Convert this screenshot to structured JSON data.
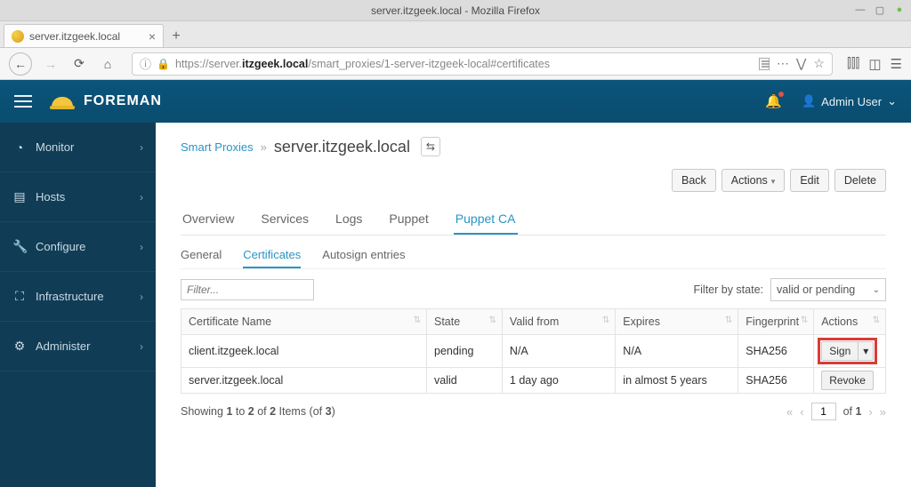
{
  "os": {
    "title": "server.itzgeek.local - Mozilla Firefox"
  },
  "browser": {
    "tab_title": "server.itzgeek.local",
    "url_prefix": "https://server.",
    "url_bold": "itzgeek.local",
    "url_suffix": "/smart_proxies/1-server-itzgeek-local#certificates"
  },
  "app": {
    "brand": "FOREMAN",
    "user_label": "Admin User"
  },
  "sidebar": {
    "items": [
      {
        "label": "Monitor",
        "icon": "dashboard"
      },
      {
        "label": "Hosts",
        "icon": "servers"
      },
      {
        "label": "Configure",
        "icon": "wrench"
      },
      {
        "label": "Infrastructure",
        "icon": "sitemap"
      },
      {
        "label": "Administer",
        "icon": "gear"
      }
    ]
  },
  "breadcrumb": {
    "root": "Smart Proxies",
    "current": "server.itzgeek.local"
  },
  "toolbar": {
    "back": "Back",
    "actions": "Actions",
    "edit": "Edit",
    "delete": "Delete"
  },
  "tabs": {
    "main": [
      "Overview",
      "Services",
      "Logs",
      "Puppet",
      "Puppet CA"
    ],
    "main_active": 4,
    "sub": [
      "General",
      "Certificates",
      "Autosign entries"
    ],
    "sub_active": 1
  },
  "filter": {
    "placeholder": "Filter...",
    "state_label": "Filter by state:",
    "state_value": "valid or pending"
  },
  "table": {
    "headers": [
      "Certificate Name",
      "State",
      "Valid from",
      "Expires",
      "Fingerprint",
      "Actions"
    ],
    "rows": [
      {
        "name": "client.itzgeek.local",
        "state": "pending",
        "valid_from": "N/A",
        "expires": "N/A",
        "fingerprint": "SHA256",
        "action": "Sign"
      },
      {
        "name": "server.itzgeek.local",
        "state": "valid",
        "valid_from": "1 day ago",
        "expires": "in almost 5 years",
        "fingerprint": "SHA256",
        "action": "Revoke"
      }
    ]
  },
  "footer": {
    "showing_pre": "Showing ",
    "from": "1",
    "to_word": " to ",
    "to": "2",
    "of_word": " of ",
    "of": "2",
    "items_pre": " Items (of ",
    "total": "3",
    "items_post": ")",
    "page": "1",
    "of_label": " of ",
    "total_pages": "1"
  }
}
